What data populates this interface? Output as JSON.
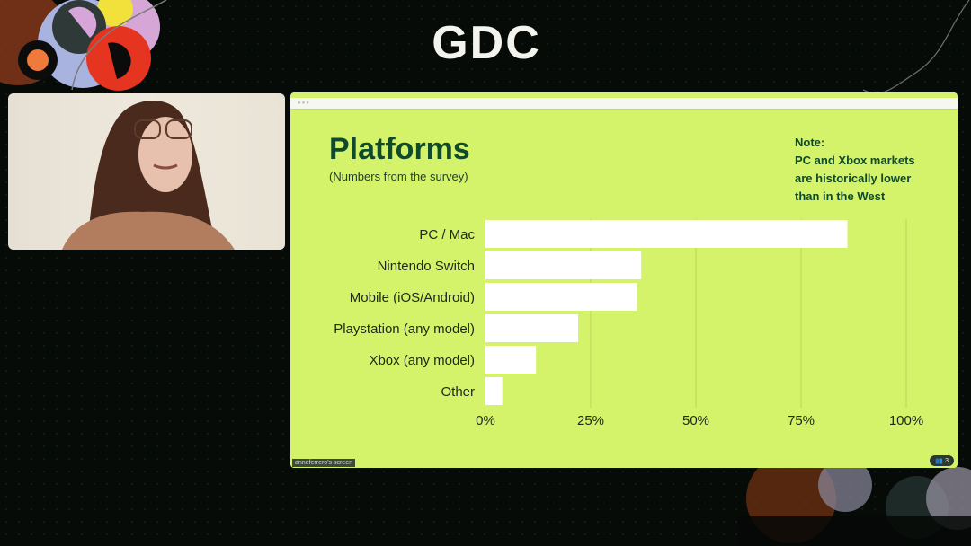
{
  "event": {
    "logo_text": "GDC"
  },
  "webcam": {
    "participant": "anneferrero"
  },
  "slide": {
    "title": "Platforms",
    "subtitle": "(Numbers from the survey)",
    "note_lines": [
      "Note:",
      "PC and Xbox markets",
      "are historically lower",
      "than in the West"
    ]
  },
  "screen_share": {
    "label": "anneferrero's screen",
    "participants_count": "3",
    "participants_icon": "people-icon"
  },
  "colors": {
    "slide_bg": "#d4f36b",
    "title": "#0f4a2c",
    "bar": "#ffffff",
    "grid": "#b8d45a"
  },
  "chart_data": {
    "type": "bar",
    "orientation": "horizontal",
    "title": "Platforms",
    "subtitle": "(Numbers from the survey)",
    "categories": [
      "PC / Mac",
      "Nintendo Switch",
      "Mobile (iOS/Android)",
      "Playstation (any model)",
      "Xbox (any model)",
      "Other"
    ],
    "values": [
      86,
      37,
      36,
      22,
      12,
      4
    ],
    "unit": "%",
    "xlabel": "",
    "ylabel": "",
    "xlim": [
      0,
      100
    ],
    "x_ticks": [
      0,
      25,
      50,
      75,
      100
    ],
    "x_tick_labels": [
      "0%",
      "25%",
      "50%",
      "75%",
      "100%"
    ],
    "grid": "vertical",
    "legend": "none"
  }
}
